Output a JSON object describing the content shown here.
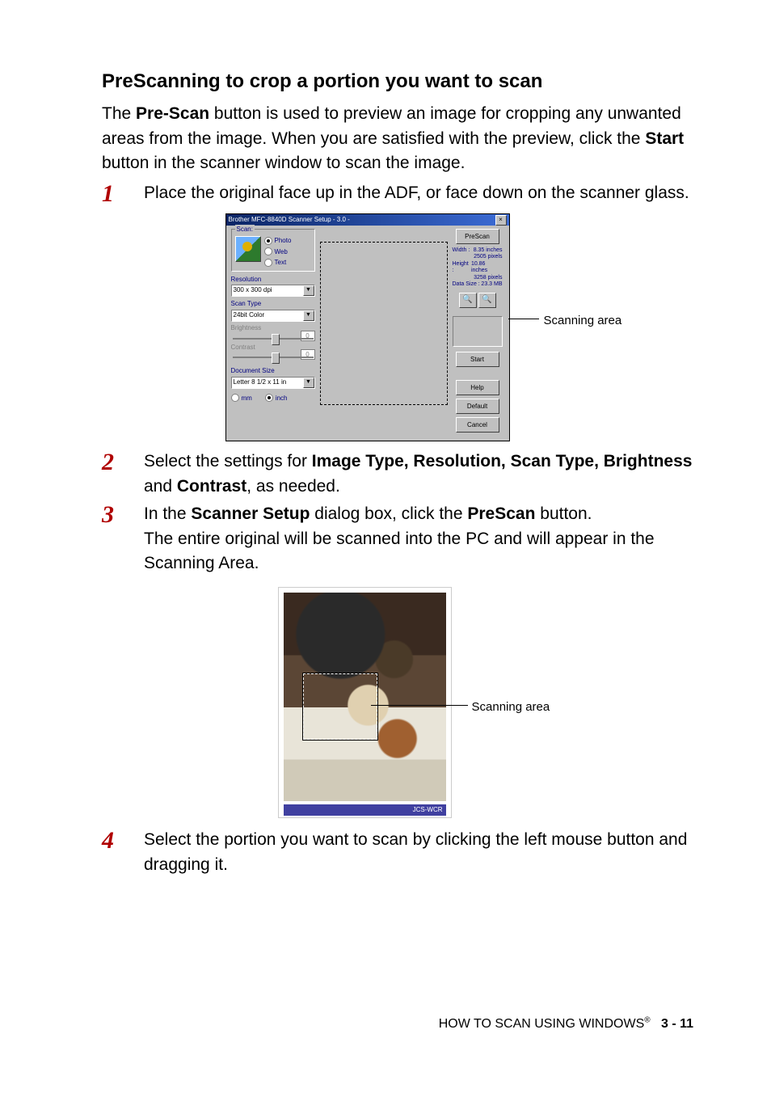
{
  "heading": "PreScanning to crop a portion you want to scan",
  "intro": {
    "pre": "The ",
    "b1": "Pre-Scan",
    "mid1": " button is used to preview an image for cropping any unwanted areas from the image. When you are satisfied with the preview, click the ",
    "b2": "Start",
    "post": " button in the scanner window to scan the image."
  },
  "steps": {
    "s1": "Place the original face up in the ADF, or face down on the scanner glass.",
    "s2_pre": "Select the settings for ",
    "s2_b1": "Image Type, Resolution, Scan Type, Brightness",
    "s2_mid": " and ",
    "s2_b2": "Contrast",
    "s2_post": ", as needed.",
    "s3_pre": "In the ",
    "s3_b1": "Scanner Setup",
    "s3_mid": " dialog box, click the ",
    "s3_b2": "PreScan",
    "s3_post1": " button.",
    "s3_line2": "The entire original will be scanned into the PC and will appear in the Scanning Area.",
    "s4": "Select the portion you want to scan by clicking the left mouse button and dragging it."
  },
  "dlg": {
    "title": "Brother MFC-8840D Scanner Setup - 3.0 -",
    "group_scan": "Scan:",
    "opt_photo": "Photo",
    "opt_web": "Web",
    "opt_text": "Text",
    "lbl_resolution": "Resolution",
    "val_resolution": "300 x 300 dpi",
    "lbl_scantype": "Scan Type",
    "val_scantype": "24bit Color",
    "lbl_brightness": "Brightness",
    "val_brightness": "0",
    "lbl_contrast": "Contrast",
    "val_contrast": "0",
    "lbl_docsize": "Document Size",
    "val_docsize": "Letter 8 1/2 x 11 in",
    "unit_mm": "mm",
    "unit_inch": "inch",
    "btn_prescan": "PreScan",
    "info_width_l": "Width :",
    "info_width_v": "8.35 inches",
    "info_width_px": "2505 pixels",
    "info_height_l": "Height :",
    "info_height_v": "10.86 inches",
    "info_height_px": "3258 pixels",
    "info_size_l": "Data Size :",
    "info_size_v": "23.3 MB",
    "btn_start": "Start",
    "btn_help": "Help",
    "btn_default": "Default",
    "btn_cancel": "Cancel"
  },
  "callouts": {
    "scanning_area": "Scanning area"
  },
  "fig2_caption": "JCS-WCR",
  "footer": {
    "text": "HOW TO SCAN USING WINDOWS",
    "page": "3 - 11"
  }
}
